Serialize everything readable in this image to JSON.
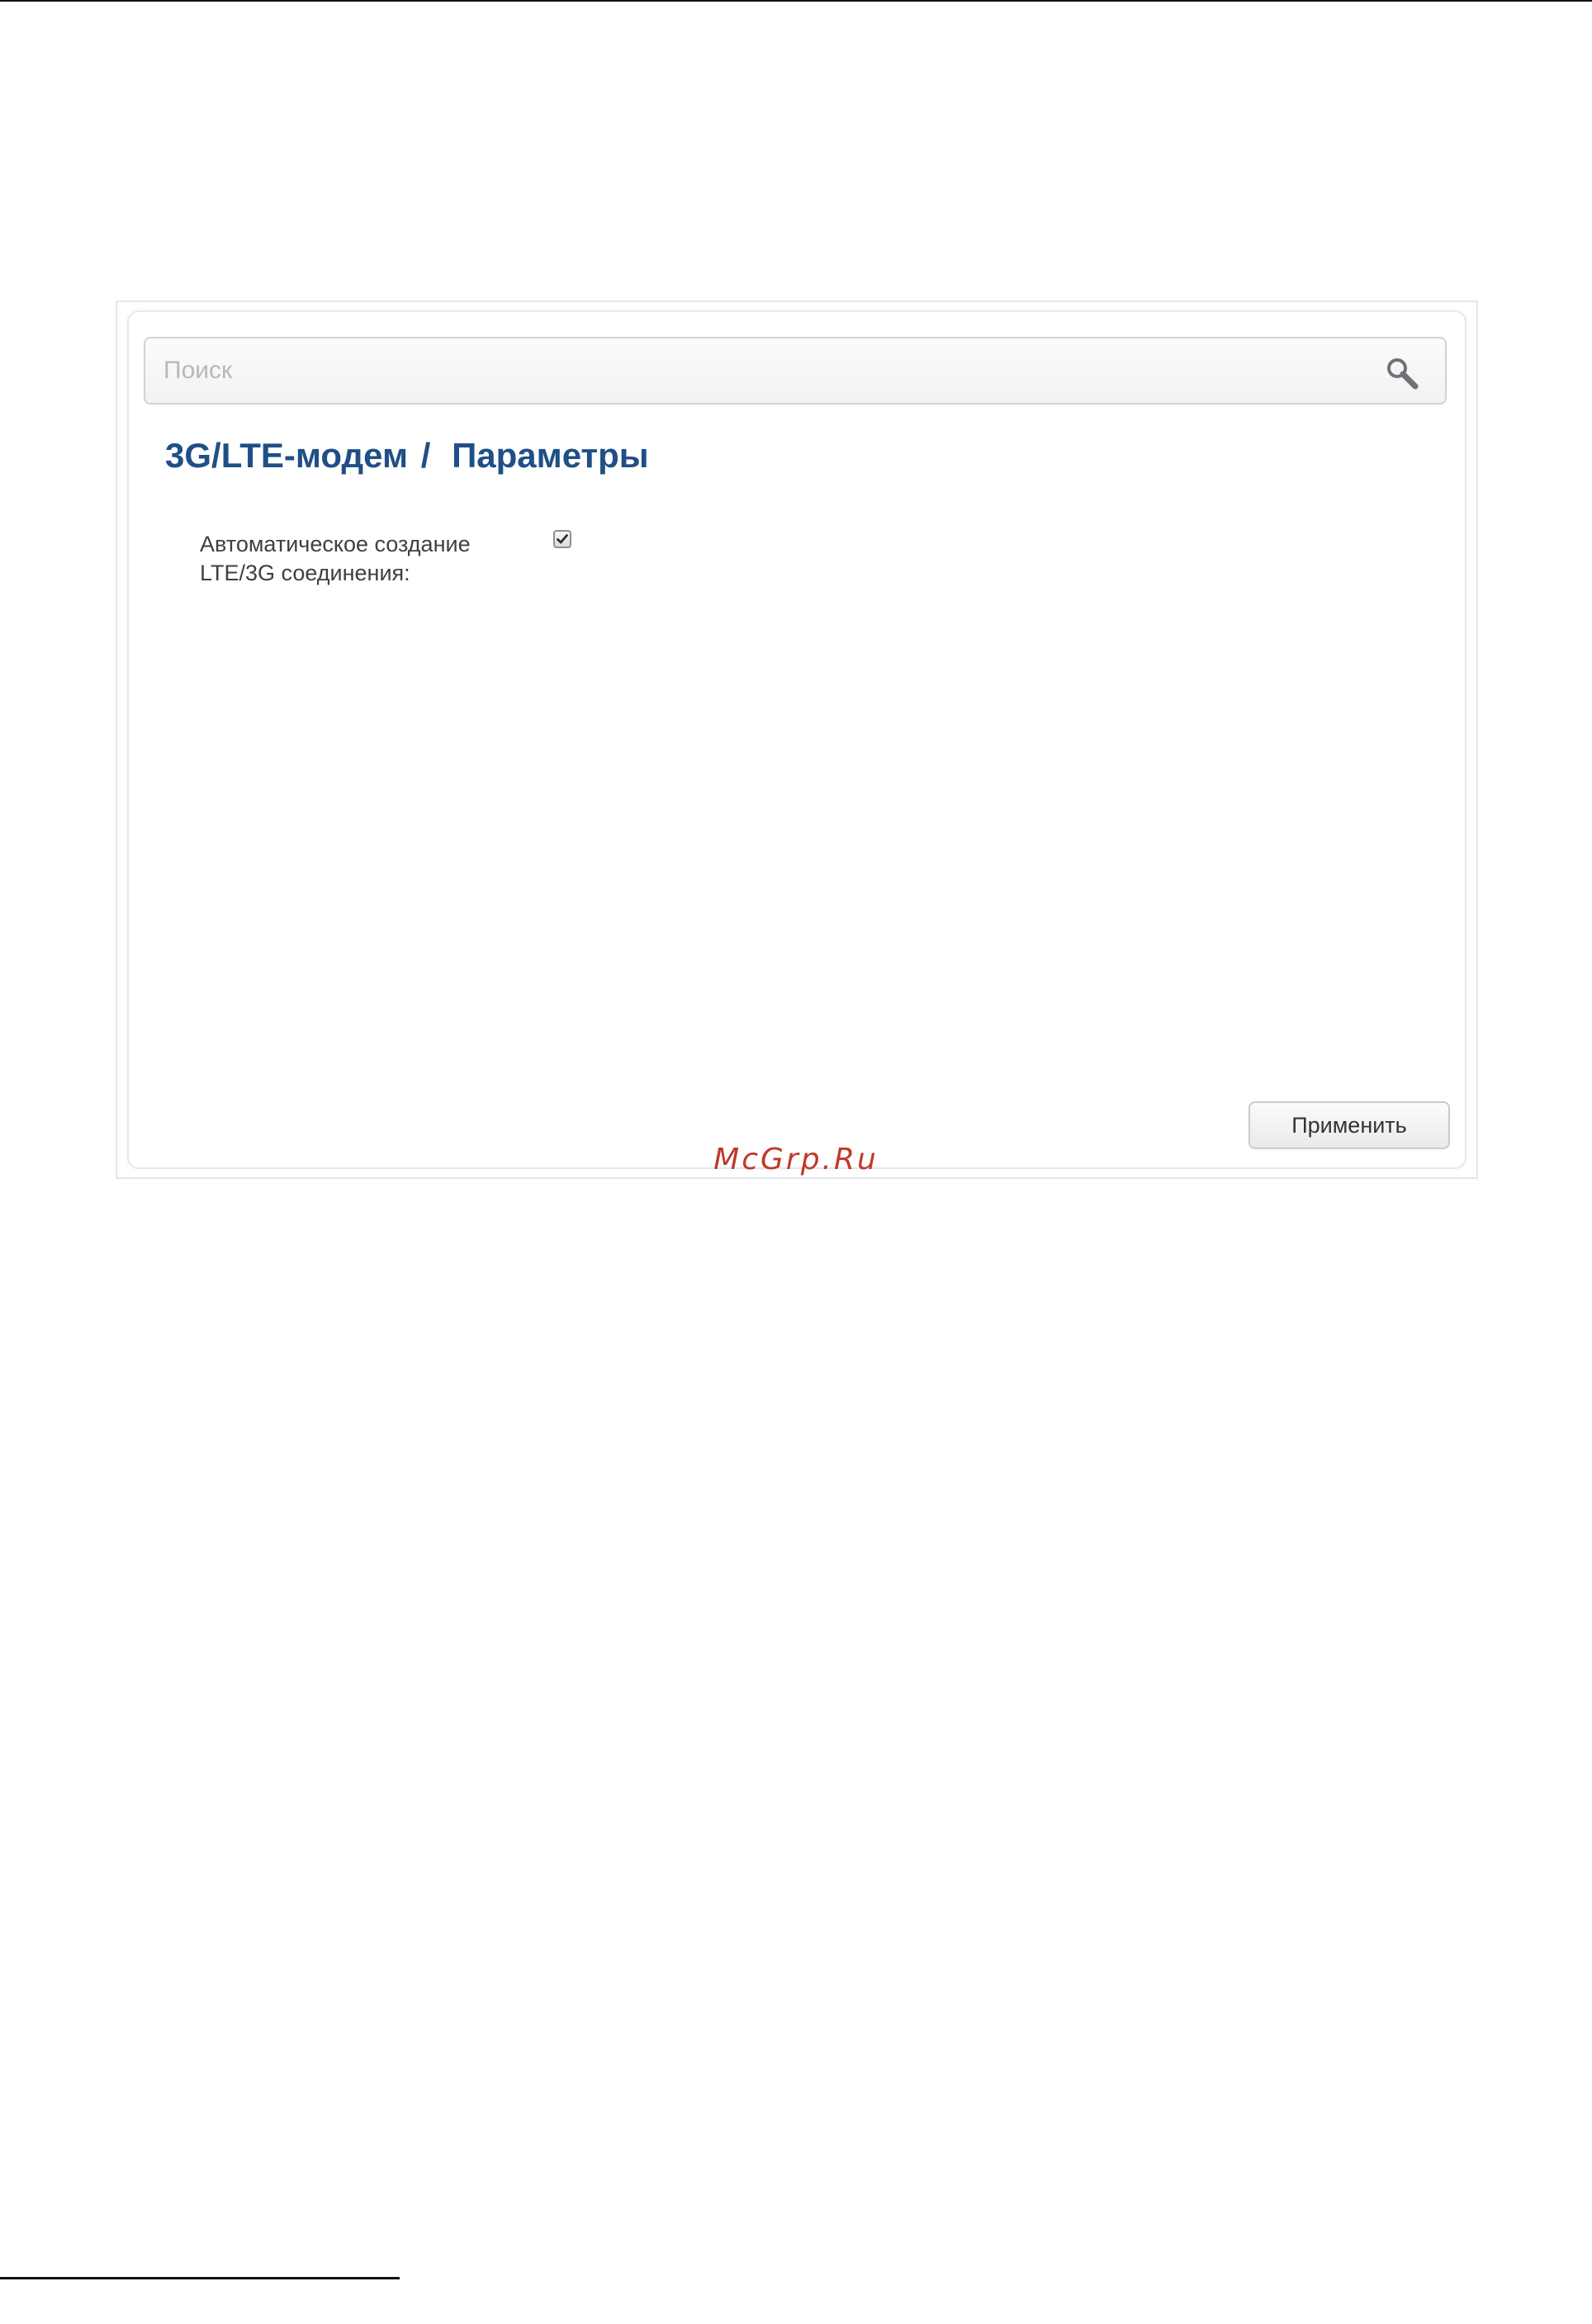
{
  "search": {
    "placeholder": "Поиск",
    "value": ""
  },
  "breadcrumb": {
    "section": "3G/LTE-модем",
    "separator": "/",
    "page": "Параметры"
  },
  "settings": {
    "auto_connection": {
      "label_line1": "Автоматическое создание",
      "label_line2": "LTE/3G соединения:",
      "checked": true
    }
  },
  "actions": {
    "apply_label": "Применить"
  },
  "watermark": {
    "text": "McGrp.Ru"
  },
  "colors": {
    "title": "#1f4f86",
    "watermark": "#c0392b",
    "label": "#3f3f3f"
  },
  "icons": {
    "search": "search-icon",
    "check": "check-icon"
  }
}
